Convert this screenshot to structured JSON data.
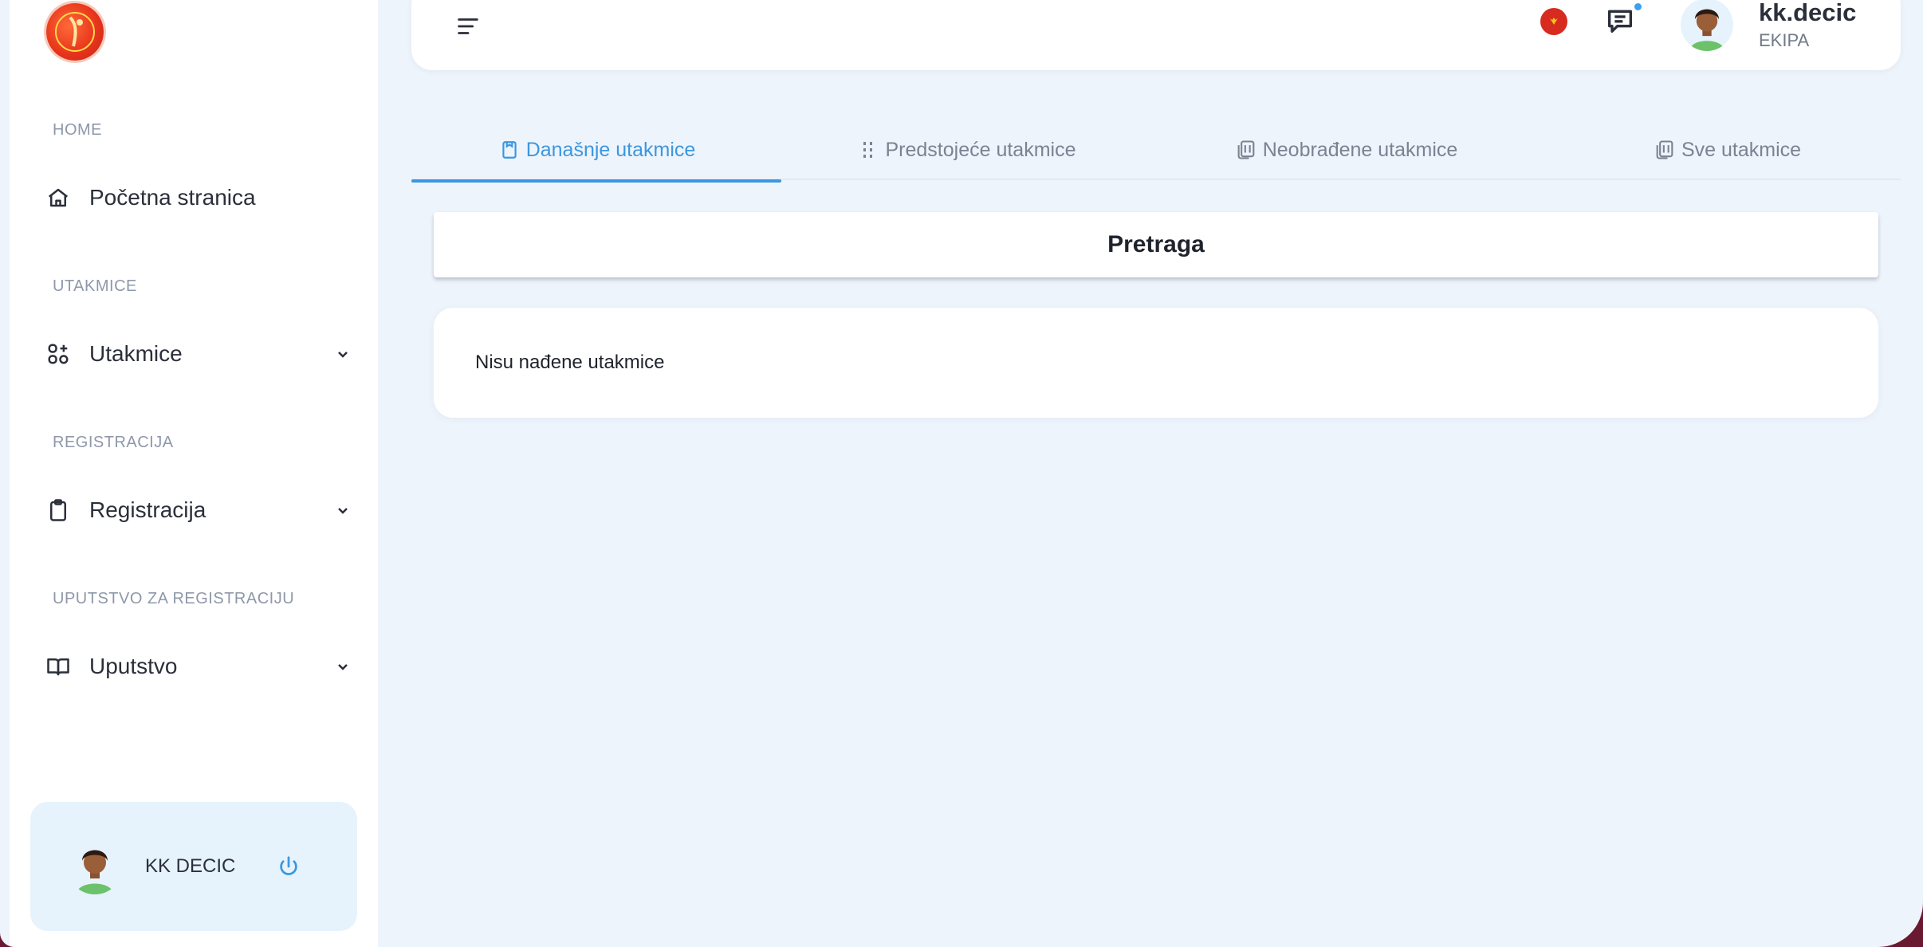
{
  "sidebar": {
    "sections": [
      {
        "label": "HOME"
      },
      {
        "label": "UTAKMICE"
      },
      {
        "label": "REGISTRACIJA"
      },
      {
        "label": "UPUTSTVO ZA REGISTRACIJU"
      }
    ],
    "items": [
      {
        "label": "Početna stranica",
        "icon": "home-icon"
      },
      {
        "label": "Utakmice",
        "icon": "apps-icon",
        "expandable": true
      },
      {
        "label": "Registracija",
        "icon": "clipboard-icon",
        "expandable": true
      },
      {
        "label": "Uputstvo",
        "icon": "book-icon",
        "expandable": true
      }
    ],
    "user_card": {
      "name": "KK DECIC"
    }
  },
  "header": {
    "user": {
      "name": "kk.decic",
      "role": "EKIPA"
    },
    "has_unread_messages": true
  },
  "tabs": [
    {
      "label": "Današnje utakmice",
      "active": true,
      "icon": "calendar-icon"
    },
    {
      "label": "Predstojeće utakmice",
      "active": false,
      "icon": "list-dots-icon"
    },
    {
      "label": "Neobrađene utakmice",
      "active": false,
      "icon": "stack-icon"
    },
    {
      "label": "Sve utakmice",
      "active": false,
      "icon": "stack-icon"
    }
  ],
  "search": {
    "label": "Pretraga"
  },
  "results": {
    "empty_message": "Nisu nađene utakmice"
  },
  "colors": {
    "accent": "#3b97e0",
    "background": "#eef4fc",
    "frame": "#6a1a30"
  }
}
